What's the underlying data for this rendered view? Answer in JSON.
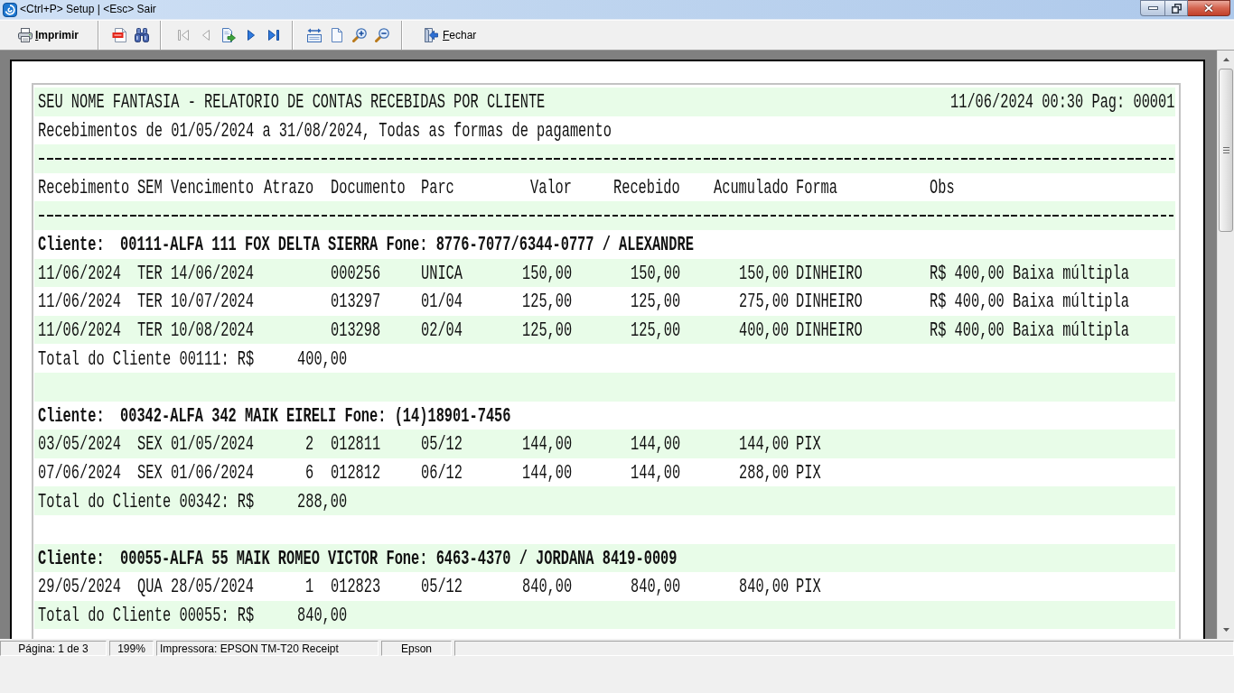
{
  "window": {
    "title": "<Ctrl+P> Setup | <Esc> Sair"
  },
  "toolbar": {
    "print_button": {
      "label": "Imprimir"
    },
    "navigation": [
      {
        "disabled": true
      },
      {
        "disabled": true
      },
      {
        "disabled": false
      },
      {
        "disabled": false
      },
      {
        "disabled": false
      }
    ],
    "close_button": {
      "label": "Fechar"
    }
  },
  "report": {
    "title": "SEU NOME FANTASIA - RELATORIO DE CONTAS RECEBIDAS POR CLIENTE",
    "timestamp": "11/06/2024 00:30 Pag: 00001",
    "subtitle": "Recebimentos de 01/05/2024 a 31/08/2024, Todas as formas de pagamento",
    "columns": [
      "Recebimento",
      "SEM",
      "Vencimento",
      "Atrazo",
      "Documento",
      "Parc",
      "Valor",
      "Recebido",
      "Acumulado",
      "Forma",
      "Obs"
    ],
    "clients": [
      {
        "label": "Cliente:",
        "info": "00111-ALFA 111 FOX DELTA SIERRA Fone: 8776-7077/6344-0777 / ALEXANDRE",
        "rows": [
          {
            "recebimento": "11/06/2024",
            "sem": "TER",
            "vencimento": "14/06/2024",
            "documento": "000256",
            "parc": "UNICA",
            "valor": "150,00",
            "recebido": "150,00",
            "acumulado": "150,00",
            "forma": "DINHEIRO",
            "obs": "R$ 400,00 Baixa múltipla"
          },
          {
            "recebimento": "11/06/2024",
            "sem": "TER",
            "vencimento": "10/07/2024",
            "documento": "013297",
            "parc": "01/04",
            "valor": "125,00",
            "recebido": "125,00",
            "acumulado": "275,00",
            "forma": "DINHEIRO",
            "obs": "R$ 400,00 Baixa múltipla"
          },
          {
            "recebimento": "11/06/2024",
            "sem": "TER",
            "vencimento": "10/08/2024",
            "documento": "013298",
            "parc": "02/04",
            "valor": "125,00",
            "recebido": "125,00",
            "acumulado": "400,00",
            "forma": "DINHEIRO",
            "obs": "R$ 400,00 Baixa múltipla"
          }
        ],
        "total": {
          "label": "Total do Cliente 00111: R$",
          "amount": "400,00"
        }
      },
      {
        "label": "Cliente:",
        "info": "00342-ALFA 342 MAIK EIRELI Fone: (14)18901-7456",
        "rows": [
          {
            "recebimento": "03/05/2024",
            "sem": "SEX",
            "vencimento": "01/05/2024",
            "atrazo": "2",
            "documento": "012811",
            "parc": "05/12",
            "valor": "144,00",
            "recebido": "144,00",
            "acumulado": "144,00",
            "forma": "PIX"
          },
          {
            "recebimento": "07/06/2024",
            "sem": "SEX",
            "vencimento": "01/06/2024",
            "atrazo": "6",
            "documento": "012812",
            "parc": "06/12",
            "valor": "144,00",
            "recebido": "144,00",
            "acumulado": "288,00",
            "forma": "PIX"
          }
        ],
        "total": {
          "label": "Total do Cliente 00342: R$",
          "amount": "288,00"
        }
      },
      {
        "label": "Cliente:",
        "info": "00055-ALFA 55 MAIK ROMEO VICTOR Fone: 6463-4370 / JORDANA 8419-0009",
        "rows": [
          {
            "recebimento": "29/05/2024",
            "sem": "QUA",
            "vencimento": "28/05/2024",
            "atrazo": "1",
            "documento": "012823",
            "parc": "05/12",
            "valor": "840,00",
            "recebido": "840,00",
            "acumulado": "840,00",
            "forma": "PIX"
          }
        ],
        "total": {
          "label": "Total do Cliente 00055: R$",
          "amount": "840,00"
        }
      }
    ]
  },
  "status_bar": {
    "page": "Página: 1 de 3",
    "zoom": "199%",
    "printer": "Impressora: EPSON TM-T20 Receipt",
    "panel_4": "Epson"
  }
}
